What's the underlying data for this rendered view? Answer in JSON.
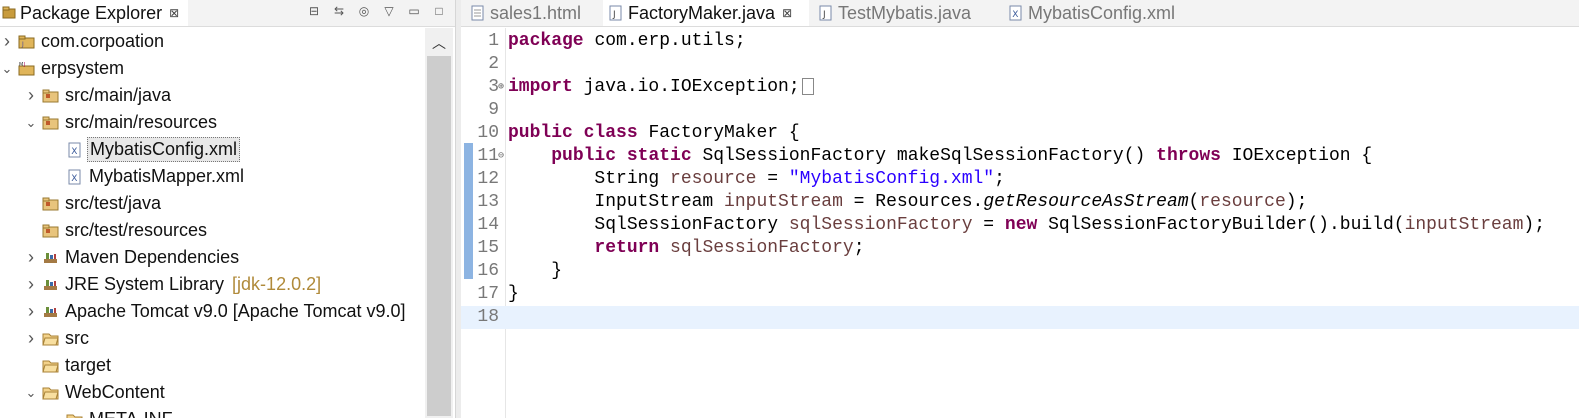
{
  "explorer": {
    "title": "Package Explorer",
    "close_glyph": "⊠",
    "toolbar": [
      {
        "name": "collapse-all-icon",
        "glyph": "⊟"
      },
      {
        "name": "link-with-editor-icon",
        "glyph": "⇆"
      },
      {
        "name": "focus-icon",
        "glyph": "◎"
      },
      {
        "name": "view-menu-icon",
        "glyph": "▽"
      },
      {
        "name": "minimize-icon",
        "glyph": "▭"
      },
      {
        "name": "maximize-icon",
        "glyph": "□"
      }
    ],
    "tree": [
      {
        "label": "com.corpoation",
        "indent": 0,
        "twisty": "collapsed",
        "icon": "project-icon"
      },
      {
        "label": "erpsystem",
        "indent": 0,
        "twisty": "expanded",
        "icon": "maven-project-icon"
      },
      {
        "label": "src/main/java",
        "indent": 1,
        "twisty": "collapsed",
        "icon": "source-folder-icon"
      },
      {
        "label": "src/main/resources",
        "indent": 1,
        "twisty": "expanded",
        "icon": "source-folder-icon"
      },
      {
        "label": "MybatisConfig.xml",
        "indent": 2,
        "twisty": "none",
        "icon": "xml-file-icon",
        "selected": true
      },
      {
        "label": "MybatisMapper.xml",
        "indent": 2,
        "twisty": "none",
        "icon": "xml-file-icon"
      },
      {
        "label": "src/test/java",
        "indent": 1,
        "twisty": "none",
        "icon": "source-folder-icon"
      },
      {
        "label": "src/test/resources",
        "indent": 1,
        "twisty": "none",
        "icon": "source-folder-icon"
      },
      {
        "label": "Maven Dependencies",
        "indent": 1,
        "twisty": "collapsed",
        "icon": "library-icon"
      },
      {
        "label": "JRE System Library",
        "decoration": "[jdk-12.0.2]",
        "indent": 1,
        "twisty": "collapsed",
        "icon": "library-icon"
      },
      {
        "label": "Apache Tomcat v9.0 [Apache Tomcat v9.0]",
        "indent": 1,
        "twisty": "collapsed",
        "icon": "library-icon"
      },
      {
        "label": "src",
        "indent": 1,
        "twisty": "collapsed",
        "icon": "folder-icon"
      },
      {
        "label": "target",
        "indent": 1,
        "twisty": "none",
        "icon": "folder-icon"
      },
      {
        "label": "WebContent",
        "indent": 1,
        "twisty": "expanded",
        "icon": "folder-icon"
      },
      {
        "label": "META-INF",
        "indent": 2,
        "twisty": "none",
        "icon": "folder-icon"
      }
    ]
  },
  "editor": {
    "tabs": [
      {
        "label": "sales1.html",
        "icon": "html-file-icon",
        "active": false
      },
      {
        "label": "FactoryMaker.java",
        "icon": "java-file-icon",
        "active": true,
        "close": "⊠"
      },
      {
        "label": "TestMybatis.java",
        "icon": "java-file-icon",
        "active": false
      },
      {
        "label": "MybatisConfig.xml",
        "icon": "xml-file-icon",
        "active": false
      }
    ],
    "lines": [
      {
        "n": "1",
        "tokens": [
          [
            "kw",
            "package"
          ],
          [
            "",
            "com.erp.utils;"
          ]
        ]
      },
      {
        "n": "2",
        "tokens": []
      },
      {
        "n": "3",
        "fold": "⊕",
        "tokens": [
          [
            "kw",
            "import"
          ],
          [
            "",
            " java.io.IOException;"
          ]
        ],
        "folded_box": true
      },
      {
        "n": "9",
        "tokens": []
      },
      {
        "n": "10",
        "tokens": [
          [
            "kw",
            "public"
          ],
          [
            "",
            " "
          ],
          [
            "kw",
            "class"
          ],
          [
            "",
            " FactoryMaker {"
          ]
        ]
      },
      {
        "n": "11",
        "fold": "⊖",
        "tokens": [
          [
            "",
            "    "
          ],
          [
            "kw",
            "public"
          ],
          [
            "",
            " "
          ],
          [
            "kw",
            "static"
          ],
          [
            "",
            " SqlSessionFactory makeSqlSessionFactory() "
          ],
          [
            "kw",
            "throws"
          ],
          [
            "",
            " IOException {"
          ]
        ]
      },
      {
        "n": "12",
        "tokens": [
          [
            "",
            "        String "
          ],
          [
            "field",
            "resource"
          ],
          [
            "",
            " = "
          ],
          [
            "str",
            "\"MybatisConfig.xml\""
          ],
          [
            "",
            ";"
          ]
        ]
      },
      {
        "n": "13",
        "tokens": [
          [
            "",
            "        InputStream "
          ],
          [
            "field",
            "inputStream"
          ],
          [
            "",
            " = Resources."
          ],
          [
            "ital",
            "getResourceAsStream"
          ],
          [
            "",
            "("
          ],
          [
            "field",
            "resource"
          ],
          [
            "",
            ");"
          ]
        ]
      },
      {
        "n": "14",
        "tokens": [
          [
            "",
            "        SqlSessionFactory "
          ],
          [
            "field",
            "sqlSessionFactory"
          ],
          [
            "",
            " = "
          ],
          [
            "kw",
            "new"
          ],
          [
            "",
            " SqlSessionFactoryBuilder().build("
          ],
          [
            "field",
            "inputStream"
          ],
          [
            "",
            ");"
          ]
        ]
      },
      {
        "n": "15",
        "tokens": [
          [
            "",
            "        "
          ],
          [
            "kw",
            "return"
          ],
          [
            "",
            " "
          ],
          [
            "field",
            "sqlSessionFactory"
          ],
          [
            "",
            ";"
          ]
        ]
      },
      {
        "n": "16",
        "tokens": [
          [
            "",
            "    }"
          ]
        ]
      },
      {
        "n": "17",
        "tokens": [
          [
            "",
            "}"
          ]
        ]
      },
      {
        "n": "18",
        "tokens": [],
        "current": true
      }
    ]
  },
  "colors": {
    "keyword": "#7f0055",
    "string": "#2a00ff",
    "field": "#6a3e3e",
    "current_line": "#e8f2fe",
    "change_ruler": "#8db4e2"
  }
}
